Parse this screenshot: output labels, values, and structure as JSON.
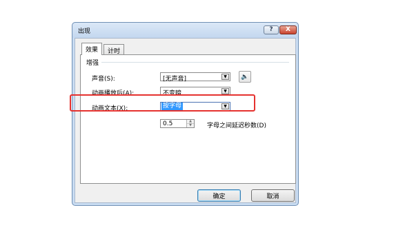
{
  "window": {
    "title": "出现"
  },
  "titlebar": {
    "help_glyph": "?",
    "close_glyph": "X"
  },
  "tabs": [
    {
      "label": "效果"
    },
    {
      "label": "计时"
    }
  ],
  "group": {
    "label": "增强"
  },
  "fields": {
    "sound": {
      "label": "声音(S):",
      "value": "[无声音]"
    },
    "after_animation": {
      "label": "动画播放后(A):",
      "value": "不变暗"
    },
    "animate_text": {
      "label": "动画文本(X):",
      "value": "按字母"
    },
    "delay": {
      "value": "0.5",
      "label": "字母之间延迟秒数(D)"
    }
  },
  "buttons": {
    "ok": "确定",
    "cancel": "取消"
  },
  "colors": {
    "highlight_box": "#e5312e",
    "selection": "#3399ff"
  },
  "icons": {
    "speaker": "speaker-icon",
    "dropdown": "chevron-down-icon"
  }
}
